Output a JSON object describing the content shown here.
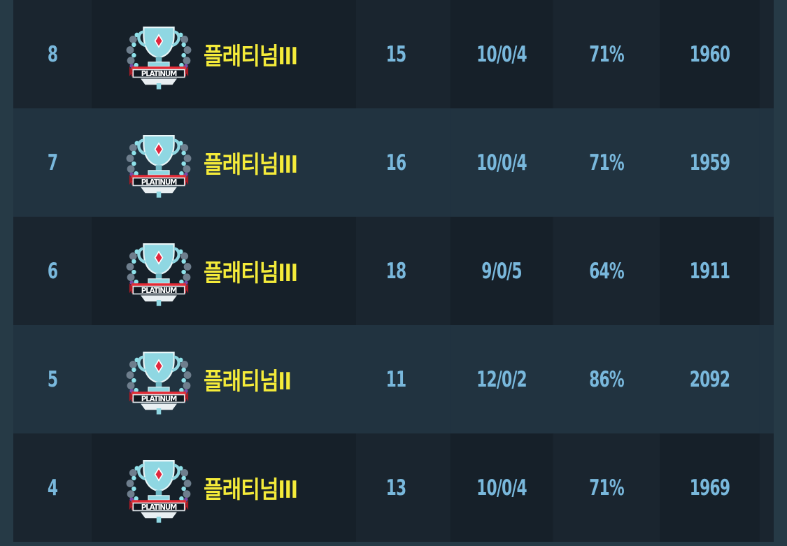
{
  "colors": {
    "background": "#263a46",
    "row_dark": "#1a252f",
    "row_light": "#213340",
    "value_text": "#79b8dc",
    "tier_text": "#f4eb3a"
  },
  "rows": [
    {
      "round": "8",
      "tier": "플래티넘III",
      "emblem_icon": "platinum-emblem-icon",
      "emblem_text": "PLATINUM",
      "rank": "15",
      "record": "10/0/4",
      "rate": "71%",
      "point": "1960"
    },
    {
      "round": "7",
      "tier": "플래티넘III",
      "emblem_icon": "platinum-emblem-icon",
      "emblem_text": "PLATINUM",
      "rank": "16",
      "record": "10/0/4",
      "rate": "71%",
      "point": "1959"
    },
    {
      "round": "6",
      "tier": "플래티넘III",
      "emblem_icon": "platinum-emblem-icon",
      "emblem_text": "PLATINUM",
      "rank": "18",
      "record": "9/0/5",
      "rate": "64%",
      "point": "1911"
    },
    {
      "round": "5",
      "tier": "플래티넘II",
      "emblem_icon": "platinum-emblem-icon",
      "emblem_text": "PLATINUM",
      "rank": "11",
      "record": "12/0/2",
      "rate": "86%",
      "point": "2092"
    },
    {
      "round": "4",
      "tier": "플래티넘III",
      "emblem_icon": "platinum-emblem-icon",
      "emblem_text": "PLATINUM",
      "rank": "13",
      "record": "10/0/4",
      "rate": "71%",
      "point": "1969"
    }
  ]
}
